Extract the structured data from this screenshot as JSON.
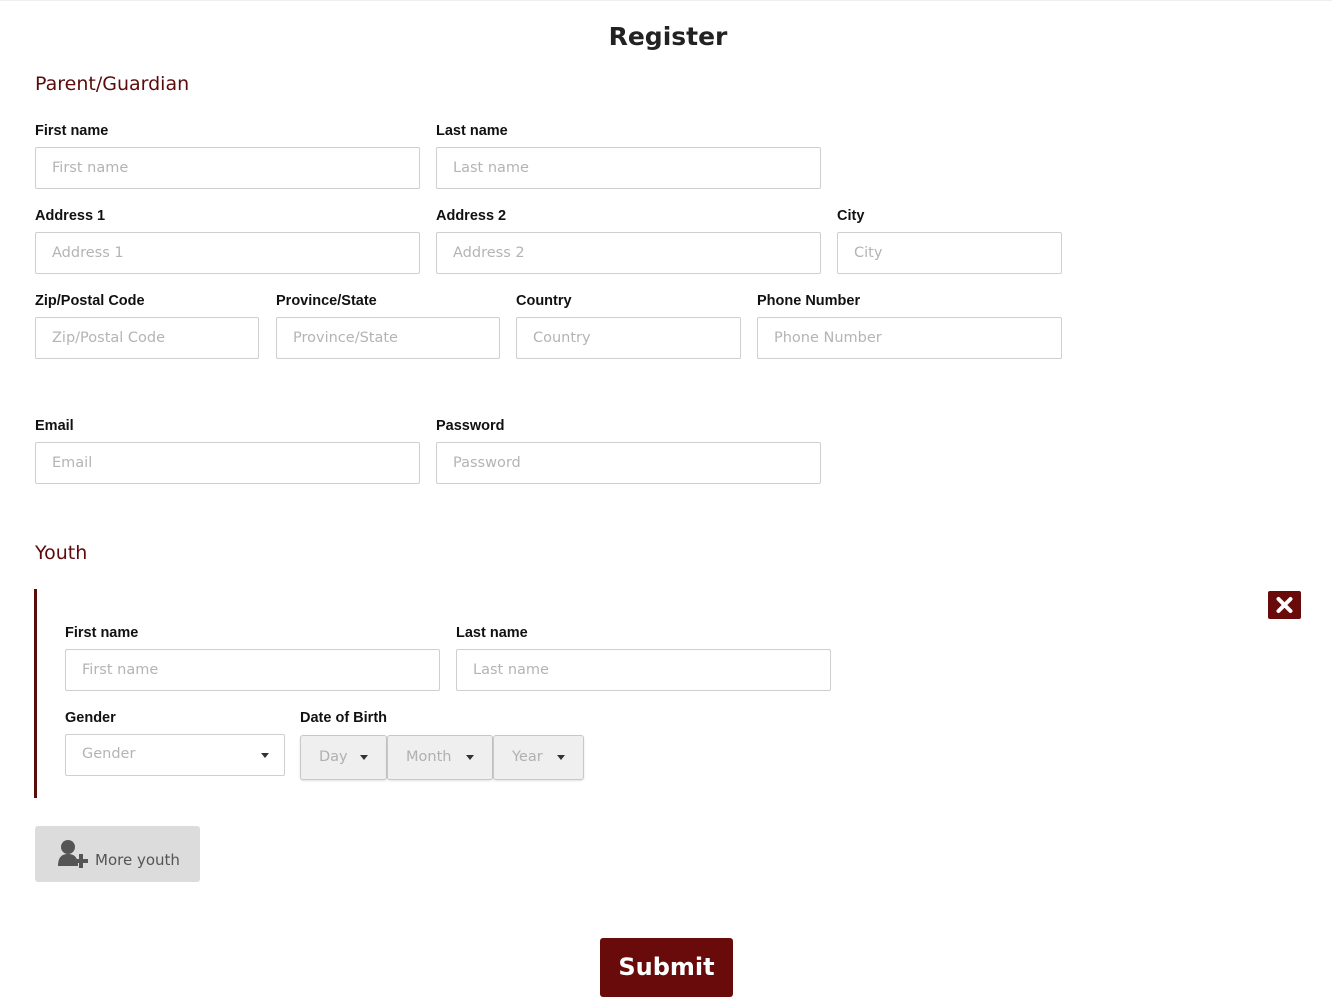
{
  "page": {
    "title": "Register"
  },
  "colors": {
    "accent": "#6a0b0b",
    "heading": "#5c0b0b",
    "input_border": "#cfcfcf",
    "placeholder": "#b4b4b4",
    "secondary_button": "#dcdcdc"
  },
  "parent": {
    "heading": "Parent/Guardian",
    "first_name": {
      "label": "First name",
      "placeholder": "First name",
      "value": ""
    },
    "last_name": {
      "label": "Last name",
      "placeholder": "Last name",
      "value": ""
    },
    "address1": {
      "label": "Address 1",
      "placeholder": "Address 1",
      "value": ""
    },
    "address2": {
      "label": "Address 2",
      "placeholder": "Address 2",
      "value": ""
    },
    "city": {
      "label": "City",
      "placeholder": "City",
      "value": ""
    },
    "zip": {
      "label": "Zip/Postal Code",
      "placeholder": "Zip/Postal Code",
      "value": ""
    },
    "province": {
      "label": "Province/State",
      "placeholder": "Province/State",
      "value": ""
    },
    "country": {
      "label": "Country",
      "placeholder": "Country",
      "value": ""
    },
    "phone": {
      "label": "Phone Number",
      "placeholder": "Phone Number",
      "value": ""
    },
    "email": {
      "label": "Email",
      "placeholder": "Email",
      "value": ""
    },
    "password": {
      "label": "Password",
      "placeholder": "Password",
      "value": ""
    }
  },
  "youth": {
    "heading": "Youth",
    "remove_icon": "close-icon",
    "first_name": {
      "label": "First name",
      "placeholder": "First name",
      "value": ""
    },
    "last_name": {
      "label": "Last name",
      "placeholder": "Last name",
      "value": ""
    },
    "gender": {
      "label": "Gender",
      "selected": "Gender"
    },
    "dob": {
      "label": "Date of Birth",
      "day": "Day",
      "month": "Month",
      "year": "Year"
    },
    "more_button": {
      "label": "More youth",
      "icon": "add-user-icon"
    }
  },
  "submit_label": "Submit"
}
